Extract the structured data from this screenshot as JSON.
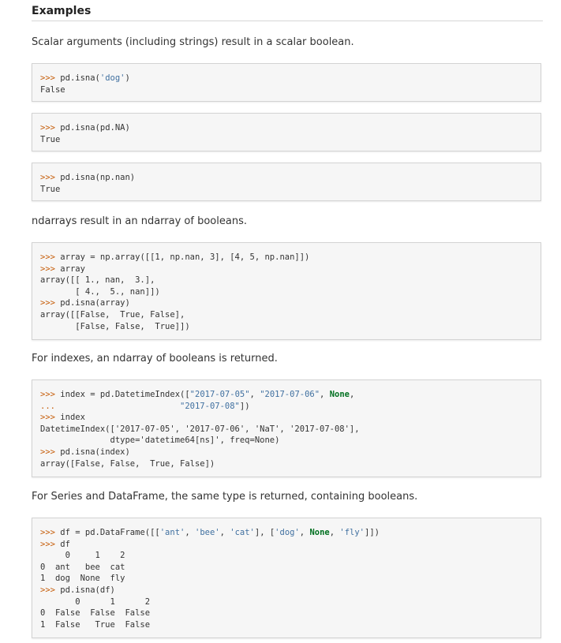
{
  "heading": "Examples",
  "paras": [
    "Scalar arguments (including strings) result in a scalar boolean.",
    "ndarrays result in an ndarray of booleans.",
    "For indexes, an ndarray of booleans is returned.",
    "For Series and DataFrame, the same type is returned, containing booleans."
  ],
  "blocks": [
    [
      [
        [
          "p",
          ">>> "
        ],
        [
          "t",
          "pd.isna("
        ],
        [
          "s",
          "'dog'"
        ],
        [
          "t",
          ")"
        ]
      ],
      [
        [
          "t",
          "False"
        ]
      ]
    ],
    [
      [
        [
          "p",
          ">>> "
        ],
        [
          "t",
          "pd.isna(pd.NA)"
        ]
      ],
      [
        [
          "t",
          "True"
        ]
      ]
    ],
    [
      [
        [
          "p",
          ">>> "
        ],
        [
          "t",
          "pd.isna(np.nan)"
        ]
      ],
      [
        [
          "t",
          "True"
        ]
      ]
    ],
    [
      [
        [
          "p",
          ">>> "
        ],
        [
          "t",
          "array = np.array([[1, np.nan, 3], [4, 5, np.nan]])"
        ]
      ],
      [
        [
          "p",
          ">>> "
        ],
        [
          "t",
          "array"
        ]
      ],
      [
        [
          "t",
          "array([[ 1., nan,  3.],"
        ]
      ],
      [
        [
          "t",
          "       [ 4.,  5., nan]])"
        ]
      ],
      [
        [
          "p",
          ">>> "
        ],
        [
          "t",
          "pd.isna(array)"
        ]
      ],
      [
        [
          "t",
          "array([[False,  True, False],"
        ]
      ],
      [
        [
          "t",
          "       [False, False,  True]])"
        ]
      ]
    ],
    [
      [
        [
          "p",
          ">>> "
        ],
        [
          "t",
          "index = pd.DatetimeIndex(["
        ],
        [
          "s",
          "\"2017-07-05\""
        ],
        [
          "t",
          ", "
        ],
        [
          "s",
          "\"2017-07-06\""
        ],
        [
          "t",
          ", "
        ],
        [
          "k",
          "None"
        ],
        [
          "t",
          ","
        ]
      ],
      [
        [
          "p",
          "... "
        ],
        [
          "t",
          "                        "
        ],
        [
          "s",
          "\"2017-07-08\""
        ],
        [
          "t",
          "])"
        ]
      ],
      [
        [
          "p",
          ">>> "
        ],
        [
          "t",
          "index"
        ]
      ],
      [
        [
          "t",
          "DatetimeIndex(['2017-07-05', '2017-07-06', 'NaT', '2017-07-08'],"
        ]
      ],
      [
        [
          "t",
          "              dtype='datetime64[ns]', freq=None)"
        ]
      ],
      [
        [
          "p",
          ">>> "
        ],
        [
          "t",
          "pd.isna(index)"
        ]
      ],
      [
        [
          "t",
          "array([False, False,  True, False])"
        ]
      ]
    ],
    [
      [
        [
          "p",
          ">>> "
        ],
        [
          "t",
          "df = pd.DataFrame([["
        ],
        [
          "s",
          "'ant'"
        ],
        [
          "t",
          ", "
        ],
        [
          "s",
          "'bee'"
        ],
        [
          "t",
          ", "
        ],
        [
          "s",
          "'cat'"
        ],
        [
          "t",
          "], ["
        ],
        [
          "s",
          "'dog'"
        ],
        [
          "t",
          ", "
        ],
        [
          "k",
          "None"
        ],
        [
          "t",
          ", "
        ],
        [
          "s",
          "'fly'"
        ],
        [
          "t",
          "]])"
        ]
      ],
      [
        [
          "p",
          ">>> "
        ],
        [
          "t",
          "df"
        ]
      ],
      [
        [
          "t",
          "     0     1    2"
        ]
      ],
      [
        [
          "t",
          "0  ant   bee  cat"
        ]
      ],
      [
        [
          "t",
          "1  dog  None  fly"
        ]
      ],
      [
        [
          "p",
          ">>> "
        ],
        [
          "t",
          "pd.isna(df)"
        ]
      ],
      [
        [
          "t",
          "       0      1      2"
        ]
      ],
      [
        [
          "t",
          "0  False  False  False"
        ]
      ],
      [
        [
          "t",
          "1  False   True  False"
        ]
      ]
    ]
  ]
}
